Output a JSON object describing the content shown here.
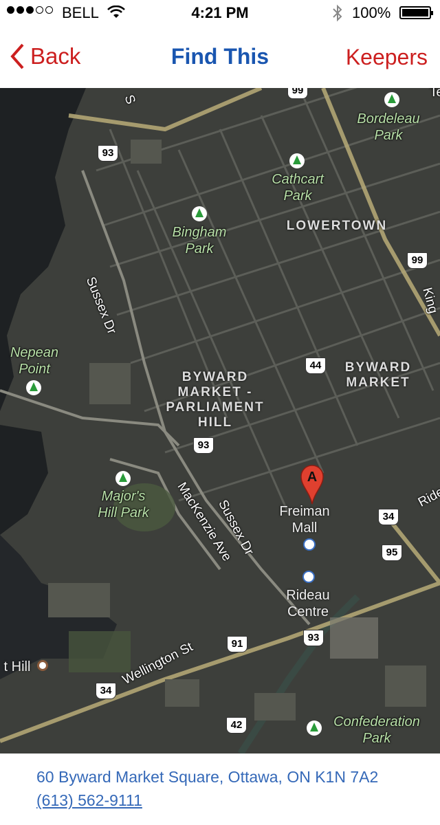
{
  "status_bar": {
    "signal_icon": "signal-dots-icon",
    "carrier": "BELL",
    "time": "4:21 PM",
    "battery_percent": "100%"
  },
  "nav": {
    "back_label": "Back",
    "title": "Find This",
    "keepers_label": "Keepers",
    "accent_red": "#cc1f1f",
    "accent_blue": "#1a56b0"
  },
  "map": {
    "parks": {
      "bordeleau": "Bordeleau\nPark",
      "cathcart": "Cathcart\nPark",
      "bingham": "Bingham\nPark",
      "nepean": "Nepean\nPoint",
      "majors_hill": "Major's\nHill Park",
      "confederation": "Confederation\nPark"
    },
    "areas": {
      "lowertown": "LOWERTOWN",
      "byward_market": "BYWARD\nMARKET",
      "byward_parliament": "BYWARD\nMARKET -\nPARLIAMENT\nHILL"
    },
    "pois": {
      "freiman_mall": "Freiman\nMall",
      "rideau_centre": "Rideau\nCentre",
      "hill_partial": "t Hill"
    },
    "roads": {
      "sussex_dr_north": "Sussex Dr",
      "sussex_dr_south": "Sussex Dr",
      "mackenzie_ave": "MacKenzie Ave",
      "wellington_st": "Wellington St",
      "king_edward_partial": "King",
      "rideau_partial": "Rideau",
      "top_partial_right": "Te",
      "top_partial_left": "S"
    },
    "shields": {
      "s93_top": "93",
      "s93_mid": "93",
      "s93_low": "93",
      "s99_right": "99",
      "s99_top": "99",
      "s44": "44",
      "s34_right": "34",
      "s34_left": "34",
      "s95": "95",
      "s91": "91",
      "s42": "42"
    },
    "pin_label": "A"
  },
  "footer": {
    "address": "60 Byward Market Square, Ottawa, ON K1N 7A2",
    "phone": "(613) 562-9111"
  }
}
